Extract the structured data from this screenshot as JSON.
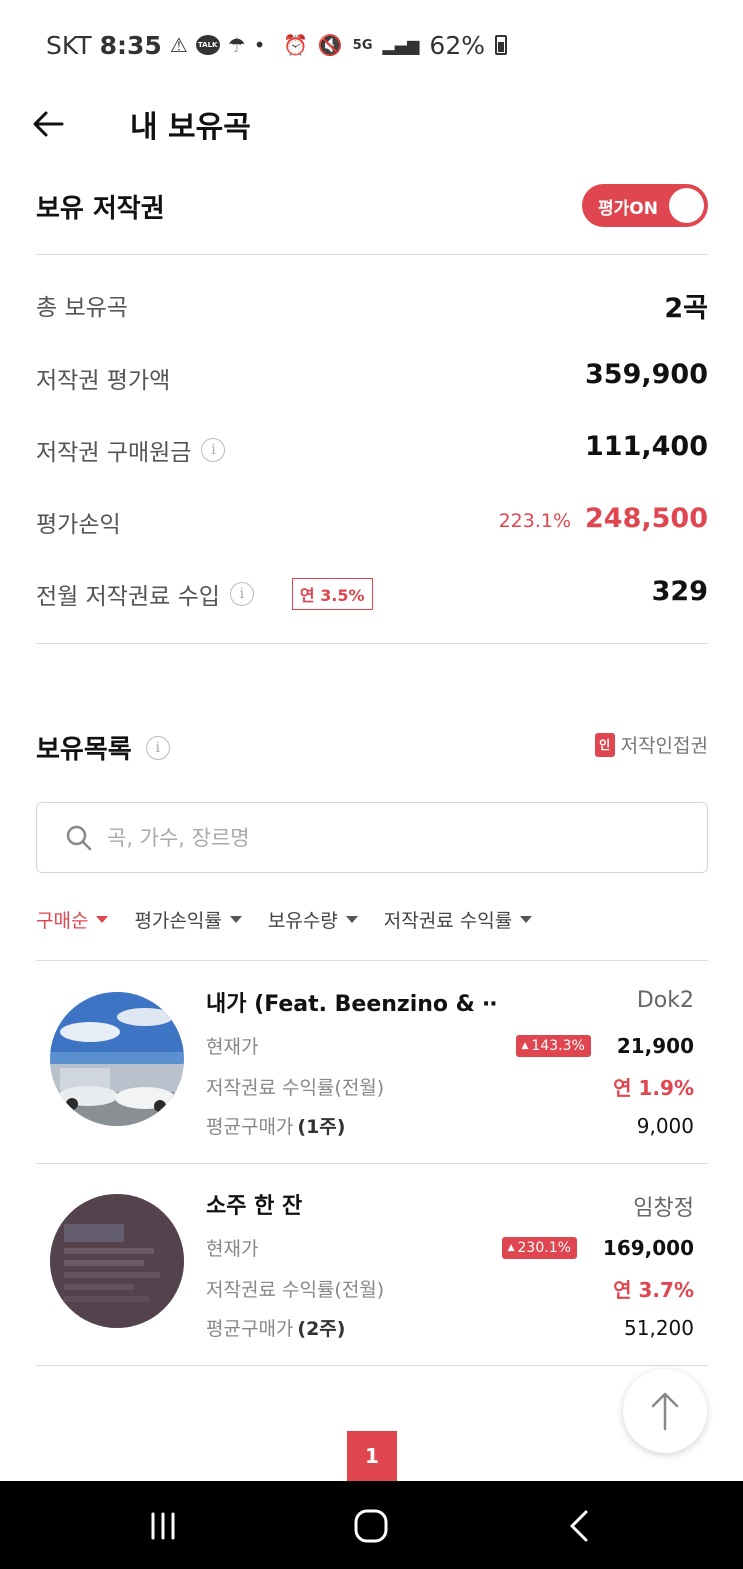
{
  "status_bar": {
    "carrier": "SKT",
    "time": "8:35",
    "talk_label": "TALK",
    "network": "5G",
    "battery": "62%"
  },
  "header": {
    "title": "내 보유곡"
  },
  "summary": {
    "title": "보유 저작권",
    "toggle_label": "평가ON",
    "rows": {
      "total": {
        "label": "총 보유곡",
        "value": "2곡"
      },
      "valuation": {
        "label": "저작권 평가액",
        "value": "359,900"
      },
      "principal": {
        "label": "저작권 구매원금",
        "value": "111,400"
      },
      "pnl": {
        "label": "평가손익",
        "pct": "223.1%",
        "value": "248,500"
      },
      "royalty": {
        "label": "전월 저작권료 수입",
        "badge": "연 3.5%",
        "value": "329"
      }
    }
  },
  "holdings": {
    "title": "보유목록",
    "legend_badge": "인",
    "legend_label": "저작인접권",
    "search_placeholder": "곡, 가수, 장르명",
    "sort_options": [
      "구매순",
      "평가손익률",
      "보유수량",
      "저작권료 수익률"
    ],
    "items": [
      {
        "title": "내가 (Feat. Beenzino & ⋯",
        "artist": "Dok2",
        "price_label": "현재가",
        "change": "143.3%",
        "price": "21,900",
        "yield_label": "저작권료 수익률(전월)",
        "yield": "연 1.9%",
        "avg_label": "평균구매가",
        "qty": "(1주)",
        "avg_price": "9,000"
      },
      {
        "title": "소주 한 잔",
        "artist": "임창정",
        "price_label": "현재가",
        "change": "230.1%",
        "price": "169,000",
        "yield_label": "저작권료 수익률(전월)",
        "yield": "연 3.7%",
        "avg_label": "평균구매가",
        "qty": "(2주)",
        "avg_price": "51,200"
      }
    ]
  },
  "pagination": {
    "current": "1"
  },
  "colors": {
    "accent": "#e0464f"
  }
}
